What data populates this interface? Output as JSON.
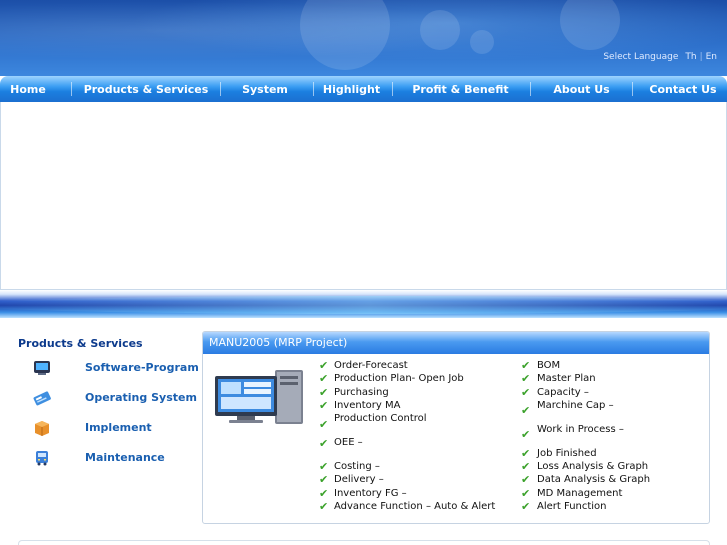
{
  "header": {
    "language": {
      "label": "Select Language",
      "options": [
        "Th",
        "En"
      ]
    }
  },
  "nav": {
    "items": [
      "Home",
      "Products & Services",
      "System",
      "Highlight",
      "Profit & Benefit",
      "About Us",
      "Contact Us"
    ]
  },
  "sidebar": {
    "title": "Products & Services",
    "items": [
      {
        "label": "Software-Program",
        "icon": "monitor-icon"
      },
      {
        "label": "Operating System",
        "icon": "card-icon"
      },
      {
        "label": "Implement",
        "icon": "box-icon"
      },
      {
        "label": "Maintenance",
        "icon": "bus-icon"
      }
    ]
  },
  "panel": {
    "title": "MANU2005 (MRP Project)",
    "left_features": [
      "Order-Forecast",
      "Production Plan- Open Job",
      "Purchasing",
      "Inventory MA",
      "Production Control",
      "OEE –",
      "Costing –",
      "Delivery –",
      "Inventory  FG –",
      "Advance  Function – Auto & Alert"
    ],
    "right_features": [
      "BOM",
      "Master Plan",
      "Capacity –",
      "Marchine Cap –",
      "Work in Process –",
      "Job  Finished",
      "Loss Analysis & Graph",
      "Data Analysis & Graph",
      "MD Management",
      "Alert Function"
    ]
  },
  "colors": {
    "nav_blue": "#1b7fe0",
    "sidebar_title": "#0c3a8c",
    "sidebar_link": "#1a5fb0",
    "check_green": "#3aa12a"
  }
}
